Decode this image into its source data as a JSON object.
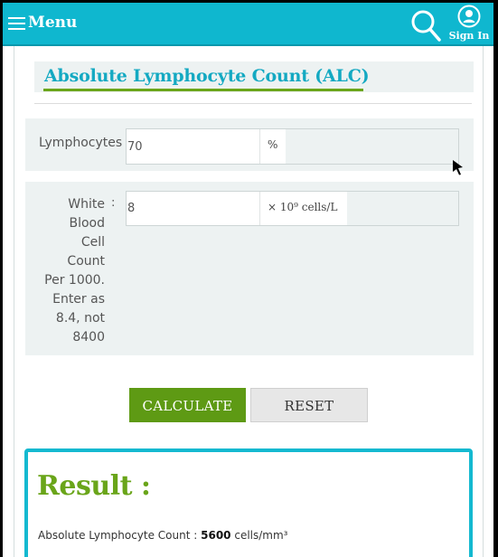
{
  "header": {
    "menu_label": "Menu",
    "signin_label": "Sign In",
    "search_icon": "search-icon",
    "user_icon": "user-circle-icon",
    "colors": {
      "bar": "#0fb7cf",
      "text": "#ffffff"
    }
  },
  "page": {
    "title": "Absolute Lymphocyte Count (ALC)",
    "accent_color": "#14a9c2",
    "underline_color": "#6aa51a"
  },
  "form": {
    "lymphocytes": {
      "label": "Lymphocytes",
      "separator": ":",
      "value": "70",
      "unit": "%"
    },
    "wbc": {
      "label_lines": [
        "White",
        "Blood",
        "Cell",
        "Count",
        "Per 1000.",
        "Enter as",
        "8.4, not",
        "8400"
      ],
      "separator": ":",
      "value": "8",
      "unit": "× 10⁹ cells/L"
    }
  },
  "buttons": {
    "calculate_label": "CALCULATE",
    "reset_label": "RESET",
    "calculate_color": "#5e9a14"
  },
  "result": {
    "title": "Result :",
    "label": "Absolute Lymphocyte Count : ",
    "value": "5600",
    "unit": " cells/mm³",
    "border_color": "#14b9d0"
  }
}
